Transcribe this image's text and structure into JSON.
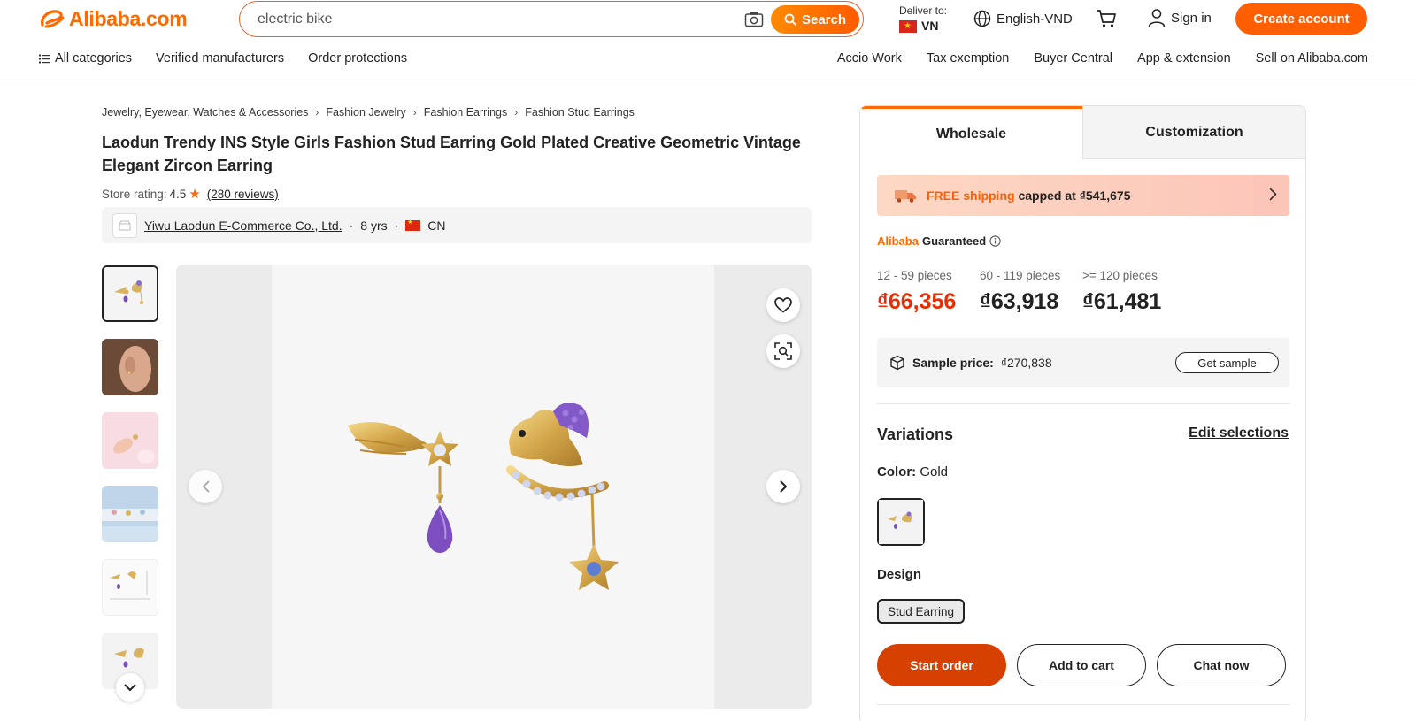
{
  "brand": {
    "logo_text": "Alibaba.com"
  },
  "search": {
    "value": "electric bike",
    "button_label": "Search"
  },
  "deliver": {
    "label": "Deliver to:",
    "country": "VN"
  },
  "language": "English-VND",
  "signin_label": "Sign in",
  "create_account_label": "Create account",
  "nav_left": [
    "All categories",
    "Verified manufacturers",
    "Order protections"
  ],
  "nav_right": [
    "Accio Work",
    "Tax exemption",
    "Buyer Central",
    "App & extension",
    "Sell on Alibaba.com"
  ],
  "breadcrumb": [
    "Jewelry, Eyewear, Watches & Accessories",
    "Fashion Jewelry",
    "Fashion Earrings",
    "Fashion Stud Earrings"
  ],
  "product": {
    "title": "Laodun Trendy INS Style Girls Fashion Stud Earring Gold Plated Creative Geometric Vintage Elegant Zircon Earring",
    "store_rating_label": "Store rating:",
    "store_rating": "4.5",
    "reviews": "(280 reviews)"
  },
  "supplier": {
    "name": "Yiwu Laodun E-Commerce Co., Ltd.",
    "years": "8 yrs",
    "country": "CN"
  },
  "panel": {
    "tabs": [
      "Wholesale",
      "Customization"
    ],
    "shipping_highlight": "FREE shipping",
    "shipping_rest": "capped at ₫541,675",
    "guarantee_a": "Alibaba",
    "guarantee_b": "Guaranteed",
    "tiers": [
      {
        "qty": "12 - 59 pieces",
        "price": "₫66,356"
      },
      {
        "qty": "60 - 119 pieces",
        "price": "₫63,918"
      },
      {
        "qty": ">= 120 pieces",
        "price": "₫61,481"
      }
    ],
    "sample_label": "Sample price:",
    "sample_price": "₫270,838",
    "sample_button": "Get sample",
    "variations_title": "Variations",
    "edit_selections": "Edit selections",
    "color_label": "Color:",
    "color_value": "Gold",
    "design_label": "Design",
    "design_option": "Stud Earring",
    "buttons": {
      "start_order": "Start order",
      "add_to_cart": "Add to cart",
      "chat_now": "Chat now"
    }
  },
  "colors": {
    "accent": "#ff6a00",
    "price_red": "#e62e04",
    "primary_button": "#d64000"
  }
}
